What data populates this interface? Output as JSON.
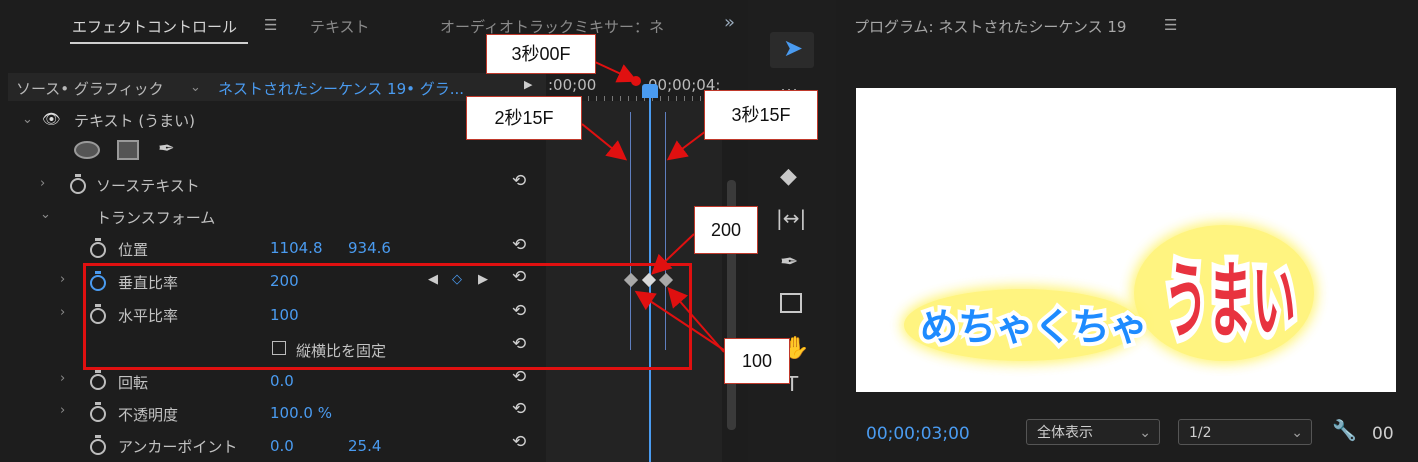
{
  "effect_controls": {
    "tabs": [
      "エフェクトコントロール",
      "テキスト",
      "オーディオトラックミキサー：ネ"
    ],
    "menu_icon": "hamburger-icon",
    "more_icon": "double-chevron-right-icon",
    "source_label": "ソース• グラフィック",
    "sequence_link": "ネストされたシーケンス 19• グラ...",
    "ruler_times": [
      ":00;00",
      "00;00;04;"
    ],
    "layer_label": "テキスト (うまい)",
    "mask_tools": [
      "ellipse-mask-icon",
      "rectangle-mask-icon",
      "pen-mask-icon"
    ],
    "source_text_label": "ソーステキスト",
    "transform_label": "トランスフォーム",
    "properties": {
      "position": {
        "label": "位置",
        "x": "1104.8",
        "y": "934.6"
      },
      "vertical_scale": {
        "label": "垂直比率",
        "value": "200"
      },
      "horizontal_scale": {
        "label": "水平比率",
        "value": "100"
      },
      "uniform": {
        "label": "縦横比を固定",
        "checked": false
      },
      "rotation": {
        "label": "回転",
        "value": "0.0"
      },
      "opacity": {
        "label": "不透明度",
        "value": "100.0 %"
      },
      "anchor": {
        "label": "アンカーポイント",
        "x": "0.0",
        "y": "25.4"
      }
    }
  },
  "tools": [
    "selection-tool-icon",
    "track-select-icon",
    "razor-icon",
    "slip-icon",
    "pen-tool-icon",
    "rectangle-tool-icon",
    "hand-tool-icon",
    "type-tool-icon"
  ],
  "program": {
    "title": "プログラム: ネストされたシーケンス 19",
    "timecode": "00;00;03;00",
    "zoom_select": "全体表示",
    "resolution_select": "1/2",
    "end_time": "00",
    "caption_blue": "めちゃくちゃ",
    "caption_red": "うまい"
  },
  "annotations": {
    "c1": "3秒00F",
    "c2": "2秒15F",
    "c3": "3秒15F",
    "c4": "200",
    "c5": "100"
  },
  "colors": {
    "accent": "#4a9bf0",
    "annotation": "#e01010"
  }
}
